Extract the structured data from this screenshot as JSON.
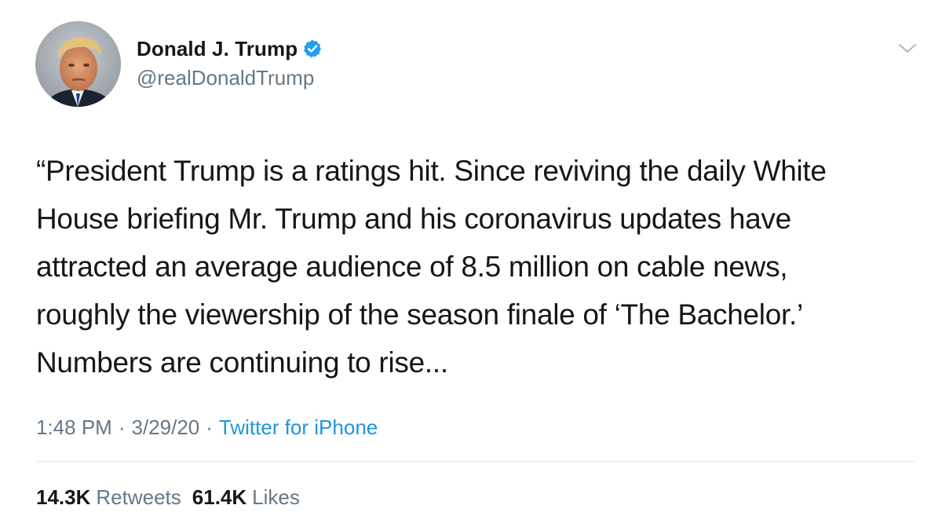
{
  "tweet": {
    "author": {
      "display_name": "Donald J. Trump",
      "handle": "@realDonaldTrump",
      "verified": true,
      "avatar_icon": "profile-photo"
    },
    "text": "“President Trump is a ratings hit. Since reviving the daily White\nHouse briefing Mr. Trump and his coronavirus updates have\nattracted an average audience of 8.5 million on cable news,\nroughly the viewership of the season finale of ‘The Bachelor.’\nNumbers are continuing to rise...",
    "time": "1:48 PM",
    "date": "3/29/20",
    "separator": "·",
    "source": "Twitter for iPhone",
    "stats": {
      "retweets_count": "14.3K",
      "retweets_label": "Retweets",
      "likes_count": "61.4K",
      "likes_label": "Likes"
    },
    "menu_icon": "chevron-down-icon"
  },
  "colors": {
    "text_primary": "#14171a",
    "text_secondary": "#657786",
    "link": "#1b95e0",
    "verified": "#1da1f2",
    "divider": "#e1e8ed"
  }
}
